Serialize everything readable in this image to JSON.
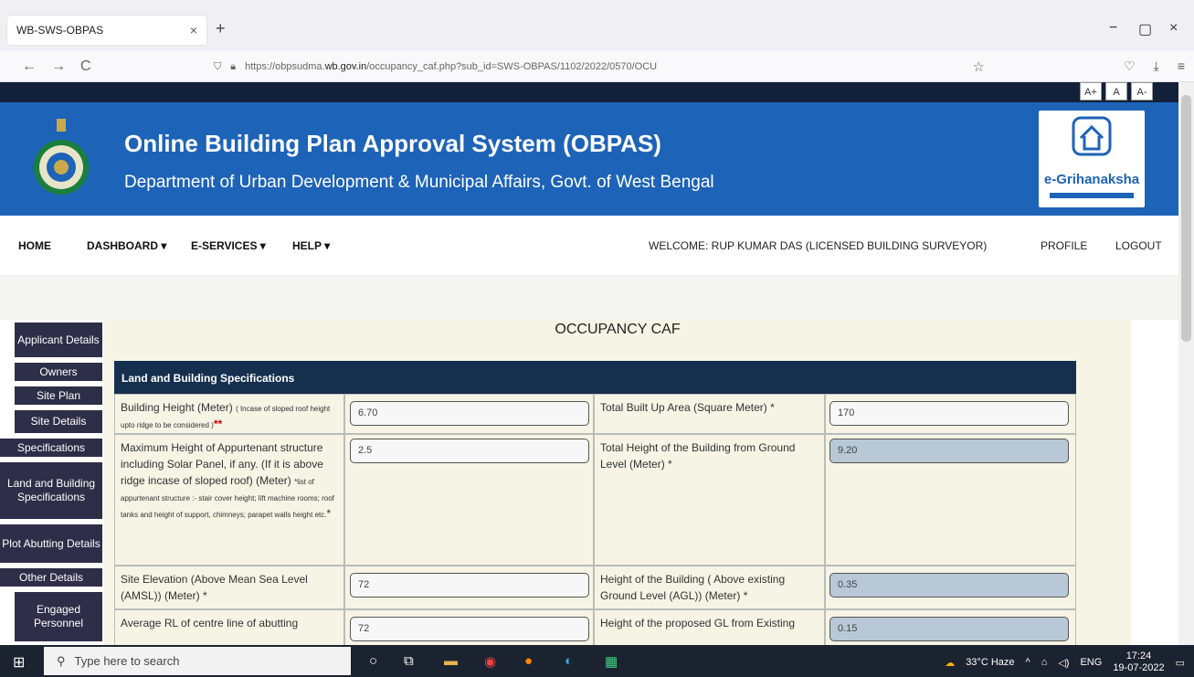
{
  "browser": {
    "tab_title": "WB-SWS-OBPAS",
    "tab_close": "×",
    "new_tab": "+",
    "url_prefix": "https://obpsudma.",
    "url_domain": "wb.gov.in",
    "url_rest": "/occupancy_caf.php?sub_id=SWS-OBPAS/1102/2022/0570/OCU",
    "back": "←",
    "forward": "→",
    "reload": "C",
    "minimize": "−",
    "maximize": "▢",
    "close": "×"
  },
  "font_buttons": [
    "A+",
    "A",
    "A-"
  ],
  "banner": {
    "title": "Online Building Plan Approval System (OBPAS)",
    "subtitle": "Department of Urban Development & Municipal Affairs, Govt. of West Bengal",
    "logo_text": "e-Grihanaksha"
  },
  "menu": {
    "items": [
      "HOME",
      "DASHBOARD ▾",
      "E-SERVICES ▾",
      "HELP ▾"
    ],
    "welcome": "WELCOME: RUP KUMAR DAS (LICENSED BUILDING SURVEYOR)",
    "profile": "PROFILE",
    "logout": "LOGOUT"
  },
  "sidebar": [
    "Applicant Details",
    "Owners",
    "Site Plan",
    "Site Details",
    "Specifications",
    "Land and Building Specifications",
    "Plot Abutting Details",
    "Other Details",
    "Engaged Personnel"
  ],
  "form": {
    "title": "OCCUPANCY CAF",
    "section": "Land and Building Specifications",
    "rows": [
      {
        "label_main": "Building Height (Meter)",
        "label_small": "( Incase of sloped roof height upto ridge to be considered )",
        "req": "**",
        "value": "6.70",
        "label2": "Total Built Up Area (Square Meter) *",
        "value2": "170"
      },
      {
        "label_main": "Maximum Height of Appurtenant structure including Solar Panel, if any. (If it is above ridge incase of sloped roof) (Meter)",
        "label_small": "*list of appurtenant structure :- stair cover height; lift machine rooms; roof tanks and height of support, chimneys; parapet walls height etc.",
        "req": "*",
        "value": "2.5",
        "label2": "Total Height of the Building from Ground Level (Meter) *",
        "value2": "9.20"
      },
      {
        "label_main": "Site Elevation (Above Mean Sea Level (AMSL)) (Meter) *",
        "value": "72",
        "label2": "Height of the Building ( Above existing Ground Level (AGL)) (Meter) *",
        "value2": "0.35"
      },
      {
        "label_main": "Average RL of centre line of abutting",
        "value": "72",
        "label2": "Height of the proposed GL from Existing",
        "value2": "0.15"
      }
    ]
  },
  "taskbar": {
    "search_placeholder": "Type here to search",
    "weather": "33°C Haze",
    "lang": "ENG",
    "time": "17:24",
    "date": "19-07-2022"
  }
}
